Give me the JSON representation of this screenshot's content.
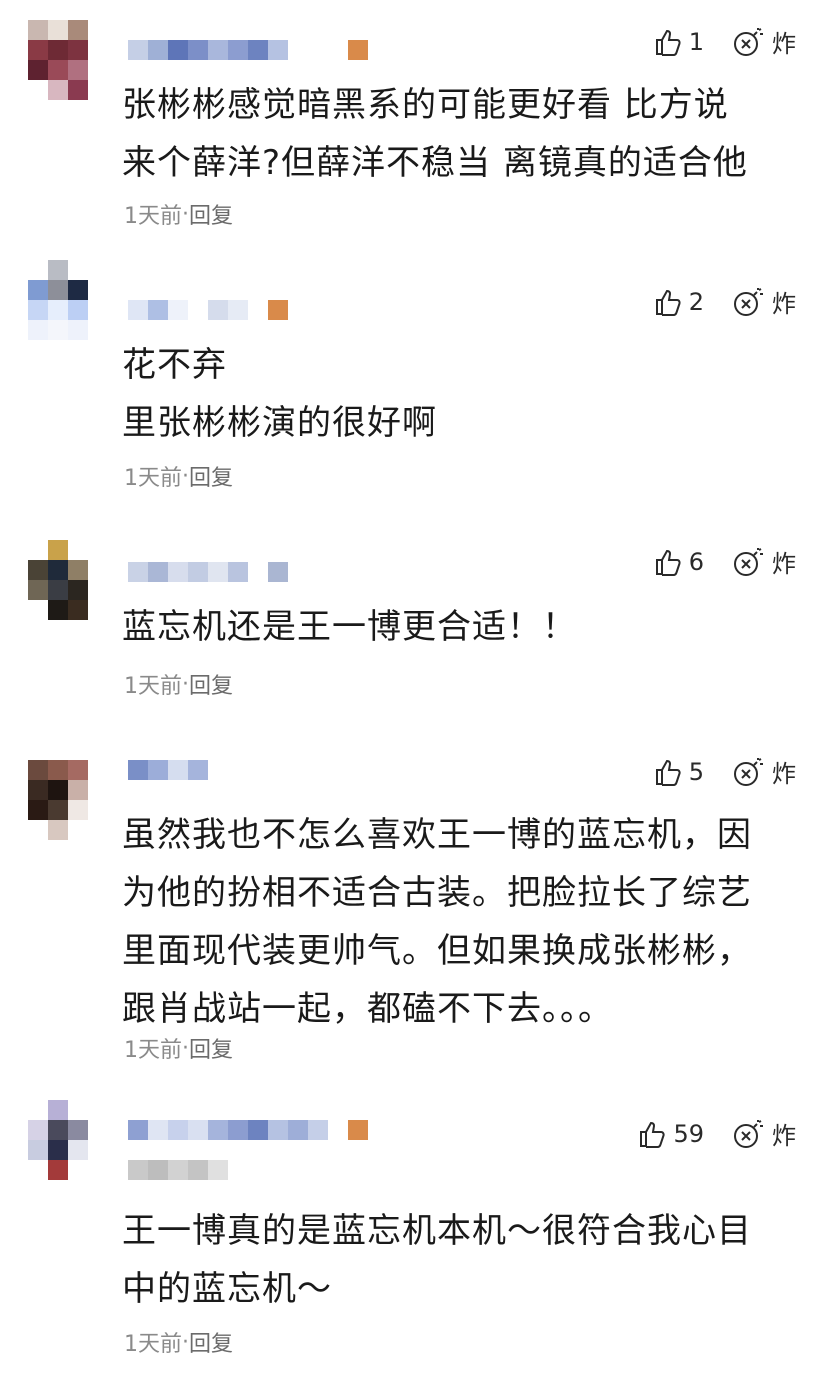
{
  "colors": {
    "text": "#1a1a1a",
    "meta": "#8a8a8a",
    "badge": "#d98a4a"
  },
  "comments": [
    {
      "likes": "1",
      "dislike_label": "炸",
      "text": "张彬彬感觉暗黑系的可能更好看 比方说\n来个薛洋?但薛洋不稳当 离镜真的适合他",
      "time": "1天前",
      "sep": "·",
      "reply": "回复"
    },
    {
      "likes": "2",
      "dislike_label": "炸",
      "text": "花不弃\n里张彬彬演的很好啊",
      "time": "1天前",
      "sep": "·",
      "reply": "回复"
    },
    {
      "likes": "6",
      "dislike_label": "炸",
      "text": "蓝忘机还是王一博更合适！！",
      "time": "1天前",
      "sep": "·",
      "reply": "回复"
    },
    {
      "likes": "5",
      "dislike_label": "炸",
      "text": "虽然我也不怎么喜欢王一博的蓝忘机，因\n为他的扮相不适合古装。把脸拉长了综艺\n里面现代装更帅气。但如果换成张彬彬，\n跟肖战站一起，都磕不下去。。。",
      "time": "1天前",
      "sep": "·",
      "reply": "回复"
    },
    {
      "likes": "59",
      "dislike_label": "炸",
      "text": "王一博真的是蓝忘机本机～很符合我心目\n中的蓝忘机～",
      "time": "1天前",
      "sep": "·",
      "reply": "回复"
    }
  ]
}
